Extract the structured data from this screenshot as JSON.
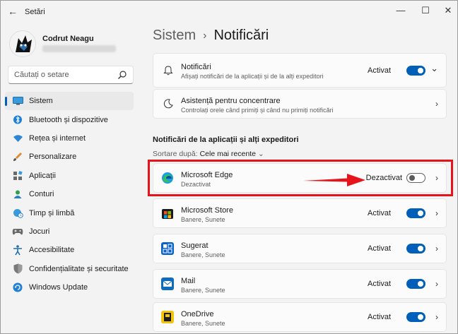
{
  "window": {
    "title": "Setări",
    "back_glyph": "←",
    "minimize_glyph": "—",
    "maximize_glyph": "☐",
    "close_glyph": "✕"
  },
  "profile": {
    "name": "Codrut Neagu"
  },
  "search": {
    "placeholder": "Căutați o setare"
  },
  "sidebar": {
    "items": [
      {
        "label": "Sistem",
        "icon": "monitor-icon",
        "active": true
      },
      {
        "label": "Bluetooth și dispozitive",
        "icon": "bluetooth-icon"
      },
      {
        "label": "Rețea și internet",
        "icon": "wifi-icon"
      },
      {
        "label": "Personalizare",
        "icon": "brush-icon"
      },
      {
        "label": "Aplicații",
        "icon": "apps-icon"
      },
      {
        "label": "Conturi",
        "icon": "person-icon"
      },
      {
        "label": "Timp și limbă",
        "icon": "globe-clock-icon"
      },
      {
        "label": "Jocuri",
        "icon": "gamepad-icon"
      },
      {
        "label": "Accesibilitate",
        "icon": "accessibility-icon"
      },
      {
        "label": "Confidențialitate și securitate",
        "icon": "shield-icon"
      },
      {
        "label": "Windows Update",
        "icon": "update-icon"
      }
    ]
  },
  "breadcrumb": {
    "parent": "Sistem",
    "separator": "›",
    "current": "Notificări"
  },
  "notifications_card": {
    "title": "Notificări",
    "subtitle": "Afișați notificări de la aplicații și de la alți expeditori",
    "status": "Activat",
    "enabled": true,
    "expand_glyph": "⌄"
  },
  "focus_card": {
    "title": "Asistență pentru concentrare",
    "subtitle": "Controlați orele când primiți și când nu primiți notificări",
    "chevron": "›"
  },
  "section": {
    "title": "Notificări de la aplicații și alți expeditori",
    "sort_label": "Sortare după:",
    "sort_value": "Cele mai recente",
    "sort_glyph": "⌄"
  },
  "apps": [
    {
      "name": "Microsoft Edge",
      "subtitle": "Dezactivat",
      "status": "Dezactivat",
      "enabled": false,
      "icon": "edge-icon"
    },
    {
      "name": "Microsoft Store",
      "subtitle": "Banere, Sunete",
      "status": "Activat",
      "enabled": true,
      "icon": "store-icon"
    },
    {
      "name": "Sugerat",
      "subtitle": "Banere, Sunete",
      "status": "Activat",
      "enabled": true,
      "icon": "suggested-icon"
    },
    {
      "name": "Mail",
      "subtitle": "Banere, Sunete",
      "status": "Activat",
      "enabled": true,
      "icon": "mail-icon"
    },
    {
      "name": "OneDrive",
      "subtitle": "Banere, Sunete",
      "status": "Activat",
      "enabled": true,
      "icon": "onedrive-icon"
    }
  ],
  "chevron": "›",
  "colors": {
    "accent": "#005fb8",
    "highlight": "#e6131b"
  }
}
